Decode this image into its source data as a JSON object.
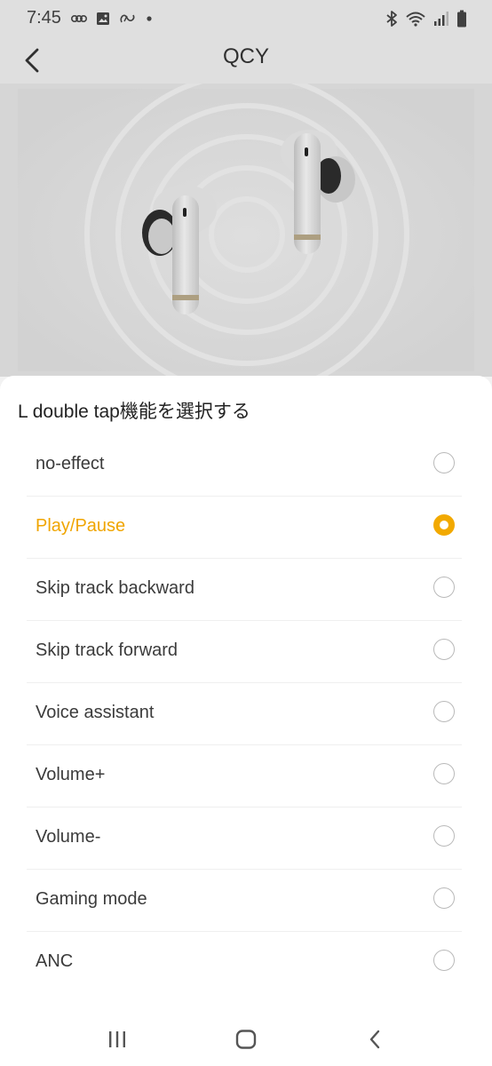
{
  "status_bar": {
    "time": "7:45",
    "left_icons": [
      "voicemail-icon",
      "image-icon",
      "link-icon",
      "dot-icon"
    ],
    "right_icons": [
      "bluetooth-icon",
      "wifi-icon",
      "signal-icon",
      "battery-icon"
    ]
  },
  "app_bar": {
    "title": "QCY",
    "back_icon": "chevron-left-icon"
  },
  "hero": {
    "image": "earbuds-product-image"
  },
  "sheet": {
    "title": "L double tap機能を選択する",
    "accent_color": "#F2A900",
    "options": [
      {
        "label": "no-effect",
        "selected": false
      },
      {
        "label": "Play/Pause",
        "selected": true
      },
      {
        "label": "Skip track backward",
        "selected": false
      },
      {
        "label": "Skip track forward",
        "selected": false
      },
      {
        "label": "Voice assistant",
        "selected": false
      },
      {
        "label": "Volume+",
        "selected": false
      },
      {
        "label": "Volume-",
        "selected": false
      },
      {
        "label": "Gaming mode",
        "selected": false
      },
      {
        "label": "ANC",
        "selected": false
      }
    ]
  },
  "nav_bar": {
    "buttons": [
      "recents-icon",
      "home-icon",
      "back-icon"
    ]
  }
}
